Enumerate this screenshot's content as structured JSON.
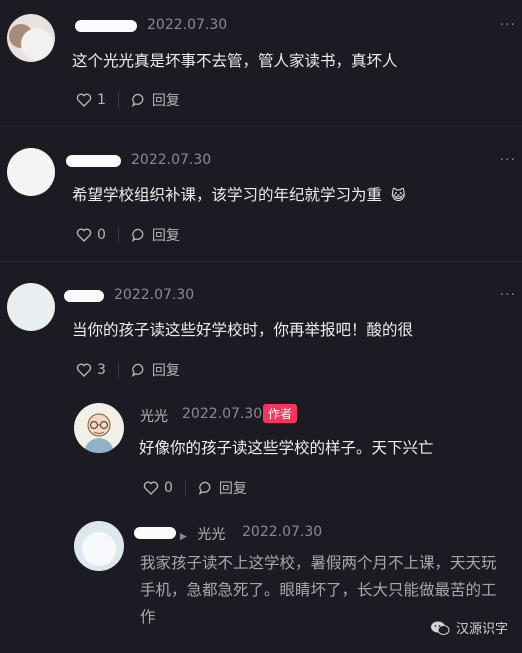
{
  "comments": [
    {
      "date": "2022.07.30",
      "text": "这个光光真是坏事不去管，管人家读书，真坏人",
      "likes": "1",
      "reply_label": "回复"
    },
    {
      "date": "2022.07.30",
      "text": "希望学校组织补课，该学习的年纪就学习为重",
      "emoji": "😺",
      "likes": "0",
      "reply_label": "回复"
    },
    {
      "date": "2022.07.30",
      "text": "当你的孩子读这些好学校时，你再举报吧！酸的很",
      "likes": "3",
      "reply_label": "回复"
    }
  ],
  "reply1": {
    "name": "光光",
    "date": "2022.07.30",
    "badge": "作者",
    "text": "好像你的孩子读这些学校的样子。天下兴亡",
    "likes": "0",
    "reply_label": "回复"
  },
  "reply2": {
    "arrow": "▶",
    "reply_to": "光光",
    "date": "2022.07.30",
    "text": "我家孩子读不上这学校，暑假两个月不上课，天天玩手机，急都急死了。眼睛坏了，长大只能做最苦的工作"
  },
  "more_label": "···",
  "watermark": {
    "text": "汉源识字",
    "icon": "wechat-icon"
  },
  "colors": {
    "background": "#1c1b24",
    "author_badge": "#f5365c"
  }
}
